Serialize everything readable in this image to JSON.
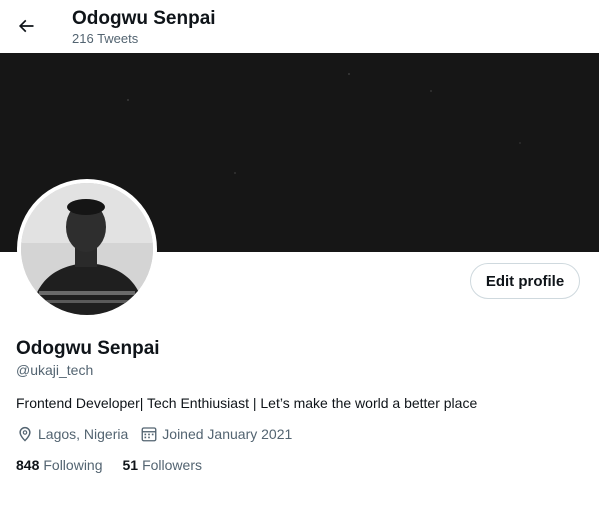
{
  "header": {
    "back_icon": "arrow-left-icon",
    "title": "Odogwu Senpai",
    "subtitle": "216 Tweets"
  },
  "profile": {
    "edit_button": "Edit profile",
    "name": "Odogwu Senpai",
    "handle": "@ukaji_tech",
    "bio": "Frontend Developer| Tech Enthiusiast | Let’s make the world a better place",
    "location_icon": "location-pin-icon",
    "location": "Lagos, Nigeria",
    "joined_icon": "calendar-icon",
    "joined": "Joined January 2021",
    "following_count": "848",
    "following_label": "Following",
    "followers_count": "51",
    "followers_label": "Followers"
  },
  "colors": {
    "banner": "#161616",
    "text_primary": "#0f1419",
    "text_secondary": "#536471",
    "button_border": "#cfd9de"
  }
}
